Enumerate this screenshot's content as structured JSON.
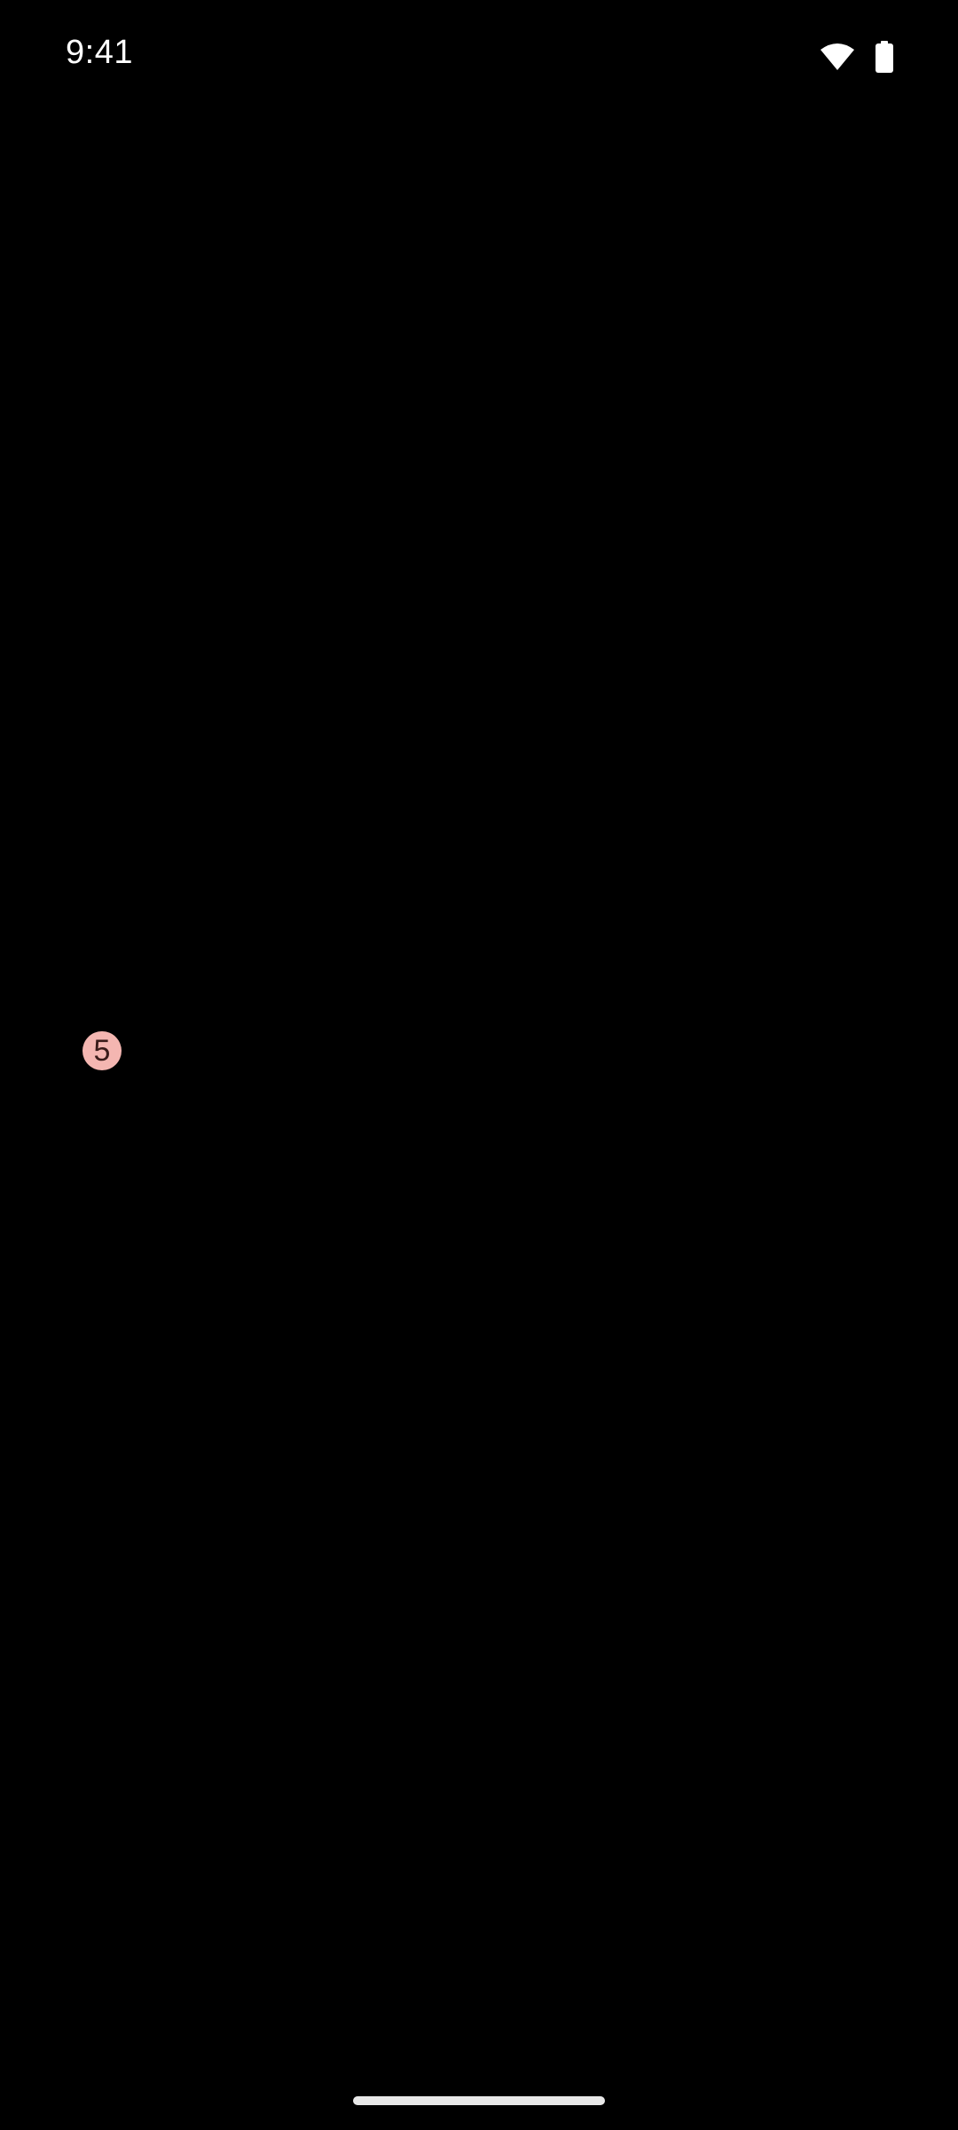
{
  "status_bar": {
    "time": "9:41",
    "icons": [
      "wifi-icon",
      "battery-icon"
    ]
  },
  "notification_badge": {
    "count": "5",
    "color": "#f4b6b1"
  },
  "theme": {
    "background": "#000000",
    "foreground": "#ffffff"
  }
}
